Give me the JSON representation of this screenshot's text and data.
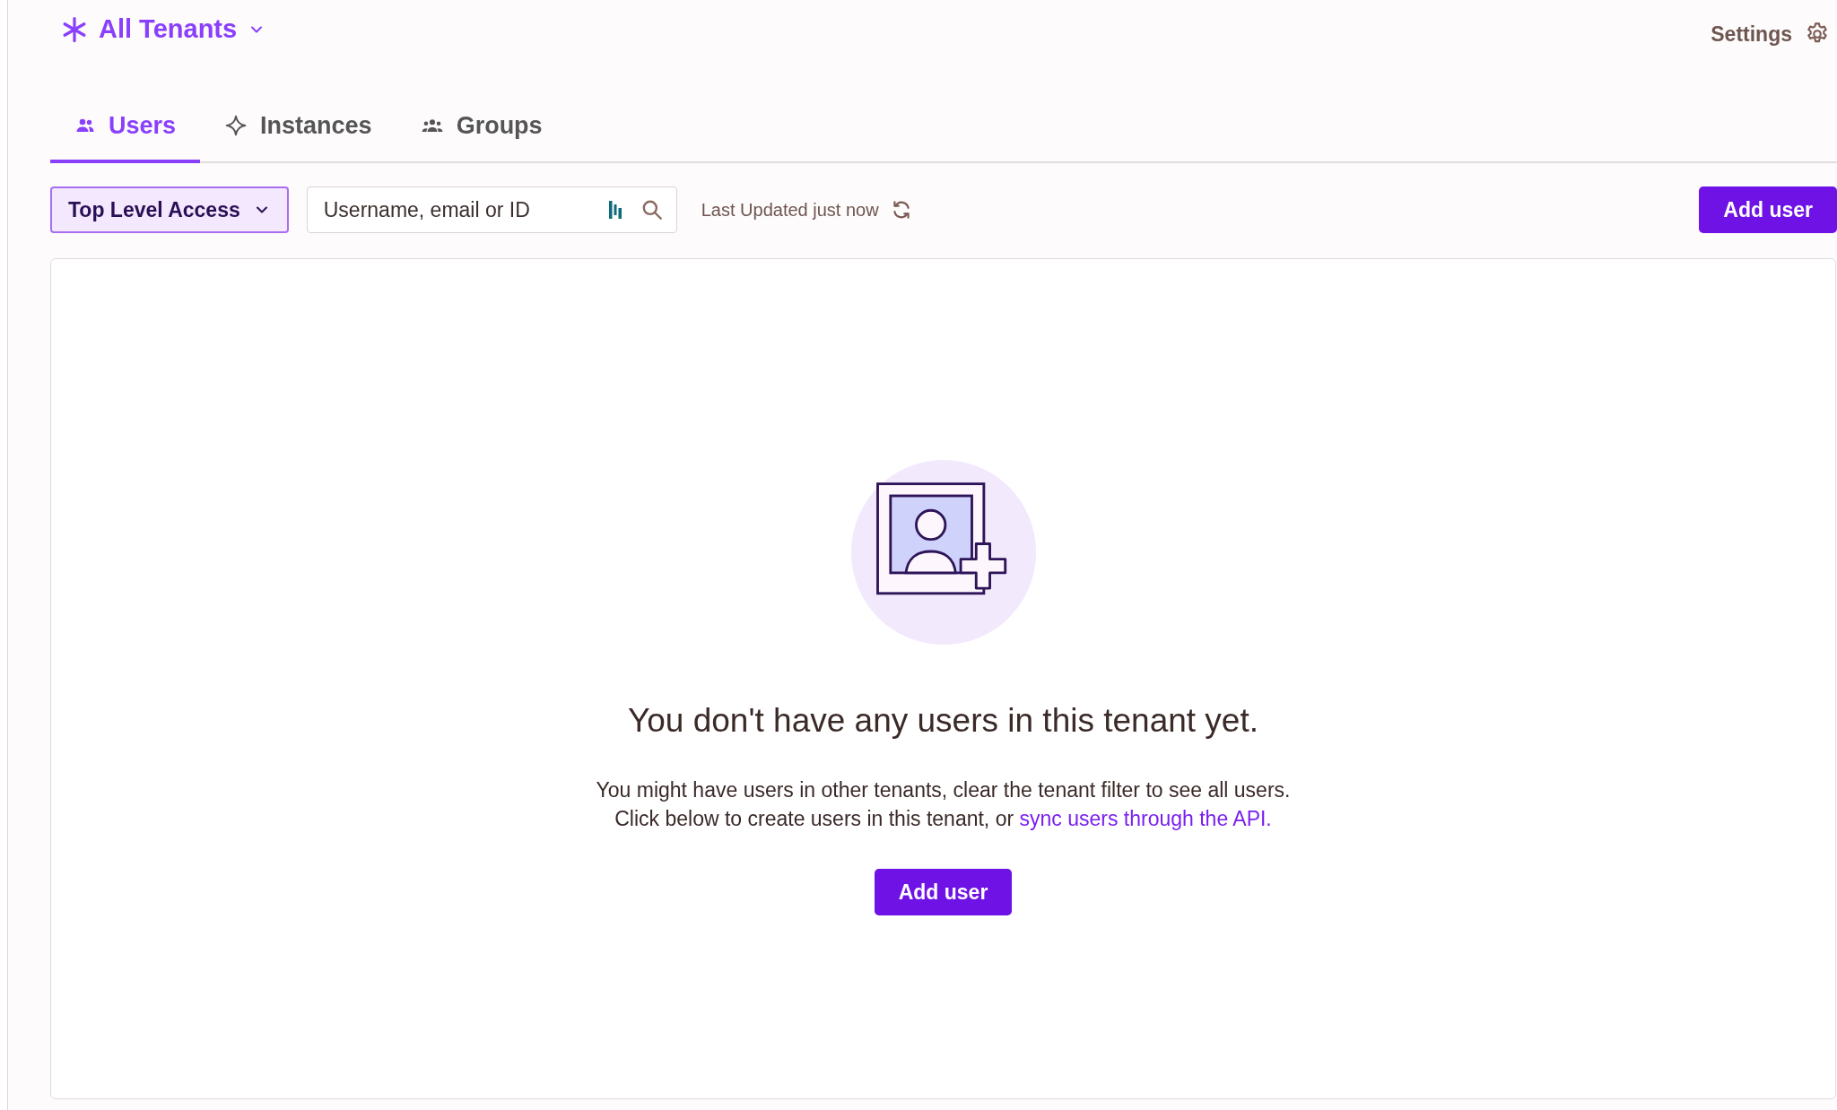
{
  "tenant_switcher": {
    "label": "All Tenants"
  },
  "settings": {
    "label": "Settings"
  },
  "tabs": [
    {
      "label": "Users",
      "selected": true
    },
    {
      "label": "Instances",
      "selected": false
    },
    {
      "label": "Groups",
      "selected": false
    }
  ],
  "toolbar": {
    "access_filter": "Top Level Access",
    "search": {
      "placeholder": "Username, email or ID"
    },
    "last_updated": "Last Updated just now",
    "add_button": "Add user"
  },
  "empty_state": {
    "heading": "You don't have any users in this tenant yet.",
    "lines": [
      "You might have users in other tenants, clear the tenant filter to see all users.",
      "Click below to create users in this tenant, or"
    ],
    "link": "sync users through the API.",
    "button": "Add user"
  }
}
